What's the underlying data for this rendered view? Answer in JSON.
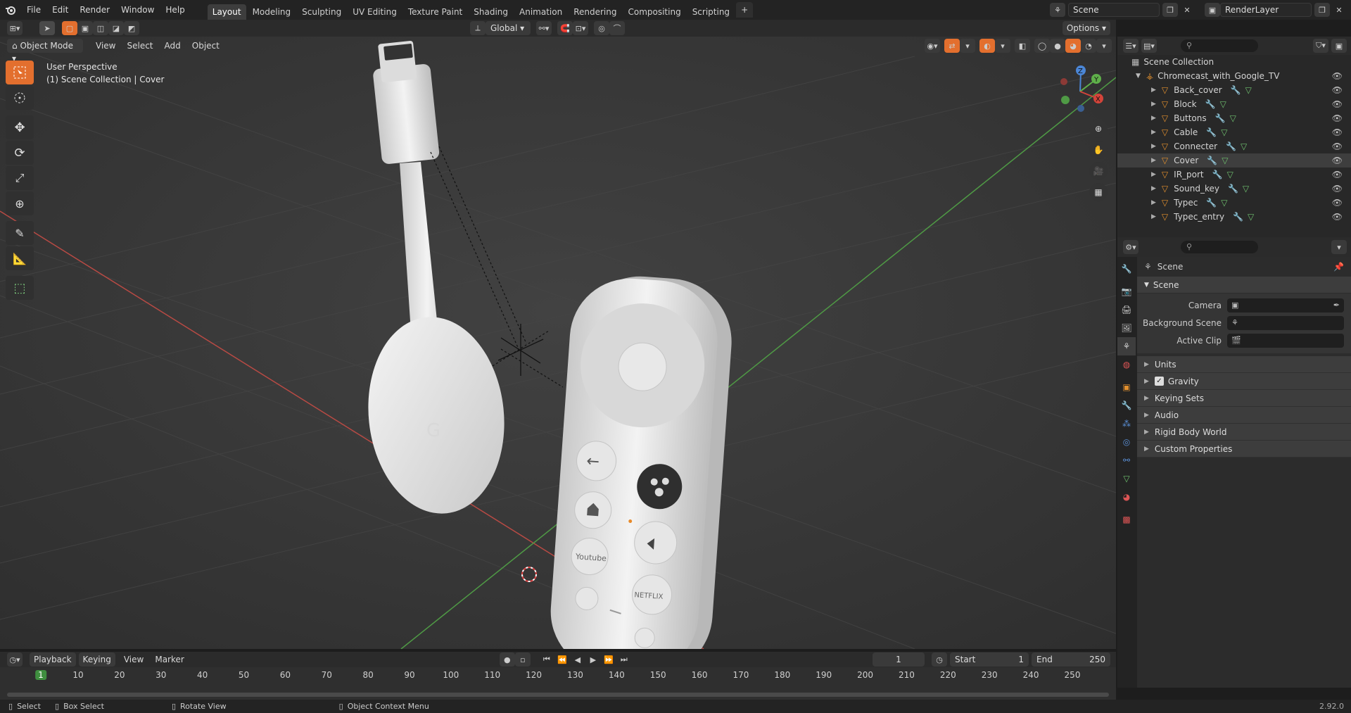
{
  "topbar": {
    "menus": [
      "File",
      "Edit",
      "Render",
      "Window",
      "Help"
    ],
    "workspaces": [
      "Layout",
      "Modeling",
      "Sculpting",
      "UV Editing",
      "Texture Paint",
      "Shading",
      "Animation",
      "Rendering",
      "Compositing",
      "Scripting"
    ],
    "active_workspace": "Layout",
    "add_tab": "+",
    "scene_name": "Scene",
    "view_layer": "RenderLayer"
  },
  "viewport": {
    "mode": "Object Mode",
    "menus": [
      "View",
      "Select",
      "Add",
      "Object"
    ],
    "transform_orientation": "Global",
    "options": "Options",
    "overlay_line1": "User Perspective",
    "overlay_line2": "(1) Scene Collection | Cover",
    "gizmo": {
      "z": "Z",
      "y": "Y",
      "x": "X"
    }
  },
  "remote": {
    "youtube": "Youtube",
    "netflix": "NETFLIX",
    "back_glyph": "←"
  },
  "outliner": {
    "root": "Scene Collection",
    "collection": "Chromecast_with_Google_TV",
    "items": [
      "Back_cover",
      "Block",
      "Buttons",
      "Cable",
      "Connecter",
      "Cover",
      "IR_port",
      "Sound_key",
      "Typec",
      "Typec_entry"
    ],
    "selected": "Cover"
  },
  "properties": {
    "context": "Scene",
    "panel": "Scene",
    "camera_label": "Camera",
    "background_label": "Background Scene",
    "clip_label": "Active Clip",
    "subpanels": [
      "Units",
      "Gravity",
      "Keying Sets",
      "Audio",
      "Rigid Body World",
      "Custom Properties"
    ]
  },
  "timeline": {
    "menus": [
      "Playback",
      "Keying",
      "View",
      "Marker"
    ],
    "current_frame": "1",
    "start_label": "Start",
    "start": "1",
    "end_label": "End",
    "end": "250",
    "ticks": [
      "1",
      "10",
      "20",
      "30",
      "40",
      "50",
      "60",
      "70",
      "80",
      "90",
      "100",
      "110",
      "120",
      "130",
      "140",
      "150",
      "160",
      "170",
      "180",
      "190",
      "200",
      "210",
      "220",
      "230",
      "240",
      "250"
    ]
  },
  "statusbar": {
    "select": "Select",
    "box_select": "Box Select",
    "rotate": "Rotate View",
    "context_menu": "Object Context Menu",
    "version": "2.92.0"
  },
  "colors": {
    "accent": "#e36f2e",
    "selection": "#3e3e3e",
    "x_axis": "#d4443a",
    "y_axis": "#5fb04a",
    "z_axis": "#4b86d6"
  }
}
